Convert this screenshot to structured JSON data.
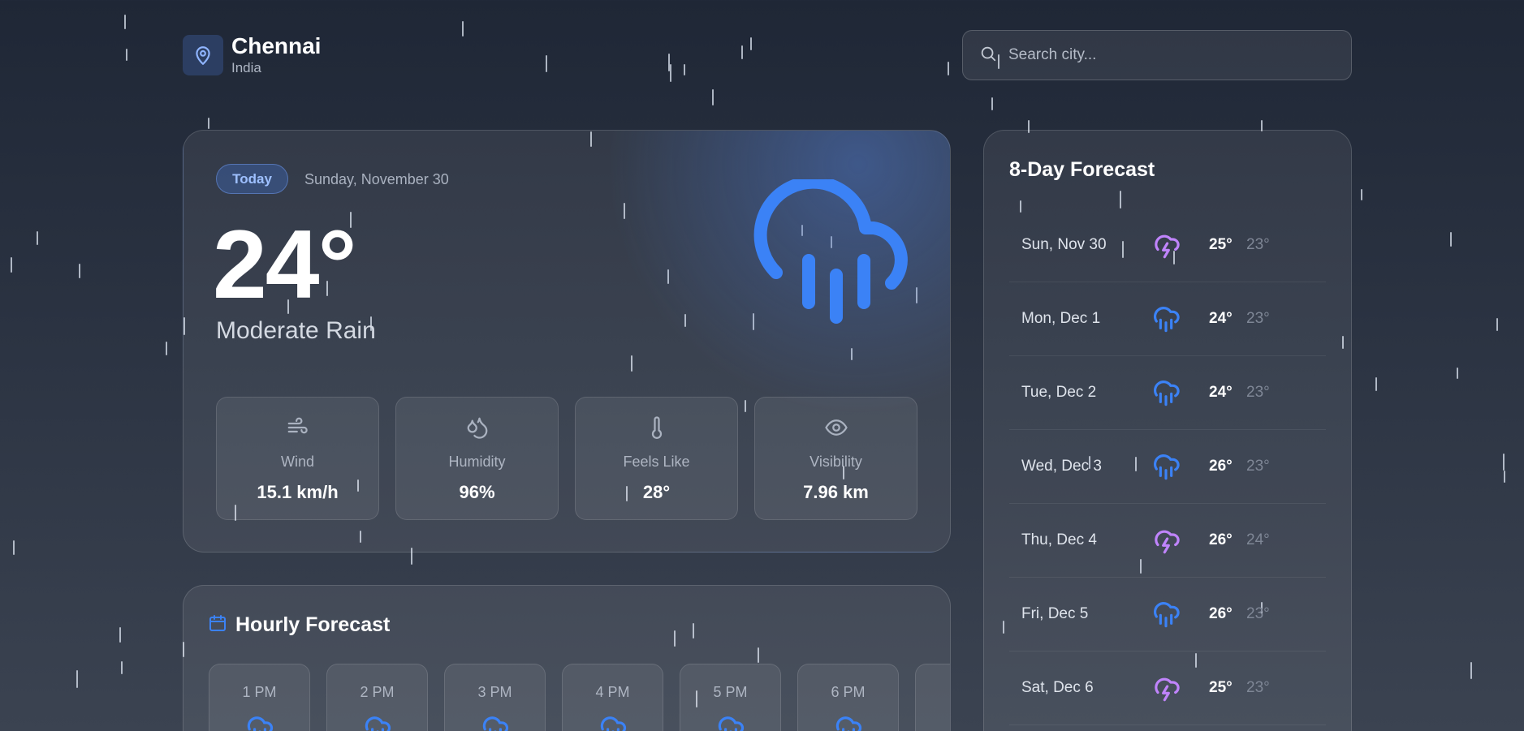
{
  "location": {
    "city": "Chennai",
    "country": "India"
  },
  "search": {
    "placeholder": "Search city..."
  },
  "current": {
    "badge": "Today",
    "date": "Sunday, November 30",
    "temperature": "24°",
    "condition": "Moderate Rain",
    "stats": [
      {
        "label": "Wind",
        "value": "15.1 km/h",
        "icon": "wind-icon"
      },
      {
        "label": "Humidity",
        "value": "96%",
        "icon": "droplets-icon"
      },
      {
        "label": "Feels Like",
        "value": "28°",
        "icon": "thermometer-icon"
      },
      {
        "label": "Visibility",
        "value": "7.96 km",
        "icon": "eye-icon"
      }
    ]
  },
  "hourly": {
    "title": "Hourly Forecast",
    "hours": [
      {
        "time": "1 PM",
        "icon": "rain-icon"
      },
      {
        "time": "2 PM",
        "icon": "rain-icon"
      },
      {
        "time": "3 PM",
        "icon": "rain-icon"
      },
      {
        "time": "4 PM",
        "icon": "rain-icon"
      },
      {
        "time": "5 PM",
        "icon": "rain-icon"
      },
      {
        "time": "6 PM",
        "icon": "rain-icon"
      },
      {
        "time": "",
        "icon": "rain-icon"
      }
    ]
  },
  "daily": {
    "title": "8-Day Forecast",
    "days": [
      {
        "name": "Sun, Nov 30",
        "high": "25°",
        "low": "23°",
        "icon": "thunderstorm-icon"
      },
      {
        "name": "Mon, Dec 1",
        "high": "24°",
        "low": "23°",
        "icon": "rain-icon"
      },
      {
        "name": "Tue, Dec 2",
        "high": "24°",
        "low": "23°",
        "icon": "rain-icon"
      },
      {
        "name": "Wed, Dec 3",
        "high": "26°",
        "low": "23°",
        "icon": "rain-icon"
      },
      {
        "name": "Thu, Dec 4",
        "high": "26°",
        "low": "24°",
        "icon": "thunderstorm-icon"
      },
      {
        "name": "Fri, Dec 5",
        "high": "26°",
        "low": "23°",
        "icon": "rain-icon"
      },
      {
        "name": "Sat, Dec 6",
        "high": "25°",
        "low": "23°",
        "icon": "thunderstorm-icon"
      }
    ]
  },
  "colors": {
    "accent": "#3b82f6",
    "storm": "#c084fc",
    "muted": "#7f8796"
  }
}
